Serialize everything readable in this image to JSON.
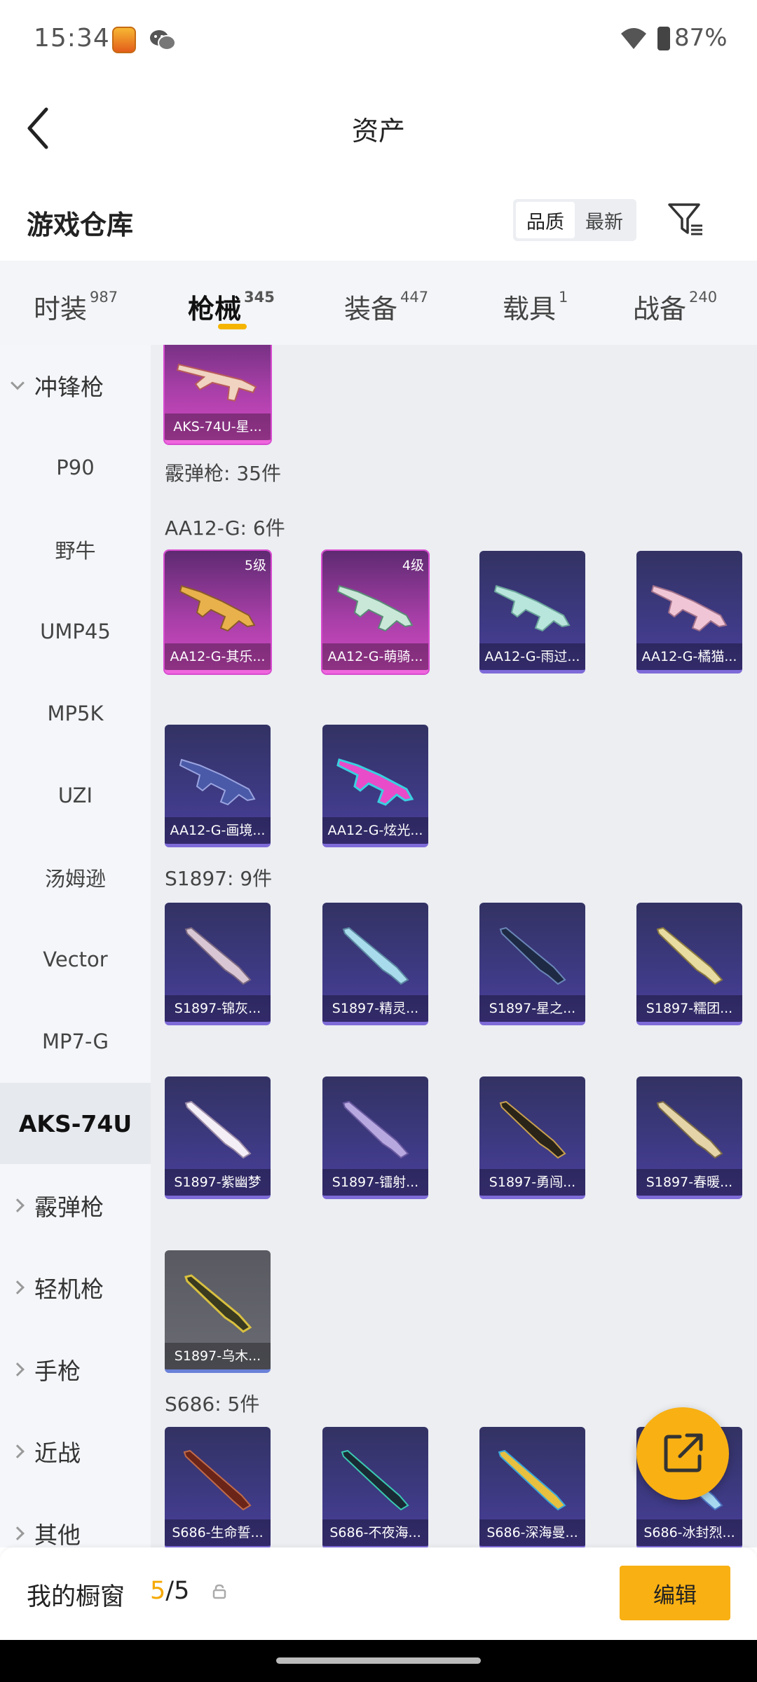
{
  "status_bar": {
    "time": "15:34",
    "battery": "87%"
  },
  "nav": {
    "title": "资产"
  },
  "header": {
    "section_title": "游戏仓库",
    "sort_options": [
      "品质",
      "最新"
    ]
  },
  "tabs": [
    {
      "label": "时装",
      "count": "987"
    },
    {
      "label": "枪械",
      "count": "345",
      "active": true
    },
    {
      "label": "装备",
      "count": "447"
    },
    {
      "label": "载具",
      "count": "1"
    },
    {
      "label": "战备",
      "count": "240"
    }
  ],
  "sidebar": [
    {
      "label": "冲锋枪",
      "type": "group",
      "expanded": true
    },
    {
      "label": "P90"
    },
    {
      "label": "野牛"
    },
    {
      "label": "UMP45"
    },
    {
      "label": "MP5K"
    },
    {
      "label": "UZI"
    },
    {
      "label": "汤姆逊"
    },
    {
      "label": "Vector"
    },
    {
      "label": "MP7-G"
    },
    {
      "label": "AKS-74U",
      "selected": true
    },
    {
      "label": "霰弹枪",
      "type": "group"
    },
    {
      "label": "轻机枪",
      "type": "group"
    },
    {
      "label": "手枪",
      "type": "group"
    },
    {
      "label": "近战",
      "type": "group"
    },
    {
      "label": "其他",
      "type": "group"
    }
  ],
  "content": {
    "top_card": {
      "name": "AKS-74U-星..."
    },
    "shotgun_total": "霰弹枪: 35件",
    "groups": [
      {
        "label": "AA12-G: 6件",
        "items": [
          {
            "name": "AA12-G-其乐...",
            "level": "5级",
            "rarity": "pink"
          },
          {
            "name": "AA12-G-萌骑...",
            "level": "4级",
            "rarity": "pink"
          },
          {
            "name": "AA12-G-雨过...",
            "rarity": "purple"
          },
          {
            "name": "AA12-G-橘猫...",
            "rarity": "purple"
          },
          {
            "name": "AA12-G-画境...",
            "rarity": "purple"
          },
          {
            "name": "AA12-G-炫光...",
            "rarity": "purple"
          }
        ]
      },
      {
        "label": "S1897: 9件",
        "items": [
          {
            "name": "S1897-锦灰...",
            "rarity": "purple"
          },
          {
            "name": "S1897-精灵...",
            "rarity": "purple"
          },
          {
            "name": "S1897-星之...",
            "rarity": "purple"
          },
          {
            "name": "S1897-糯团...",
            "rarity": "purple"
          },
          {
            "name": "S1897-紫幽梦",
            "rarity": "purple"
          },
          {
            "name": "S1897-镭射...",
            "rarity": "purple"
          },
          {
            "name": "S1897-勇闯...",
            "rarity": "purple"
          },
          {
            "name": "S1897-春暖...",
            "rarity": "purple"
          },
          {
            "name": "S1897-乌木...",
            "rarity": "grey"
          }
        ]
      },
      {
        "label": "S686: 5件",
        "items": [
          {
            "name": "S686-生命誓...",
            "rarity": "purple"
          },
          {
            "name": "S686-不夜海...",
            "rarity": "purple"
          },
          {
            "name": "S686-深海曼...",
            "rarity": "purple"
          },
          {
            "name": "S686-冰封烈...",
            "rarity": "purple"
          }
        ]
      }
    ]
  },
  "bottom_bar": {
    "label": "我的橱窗",
    "used": "5",
    "total": "/5",
    "edit_label": "编辑"
  },
  "colors": {
    "accent": "#f8b013",
    "purple_card": "#3e3a84",
    "pink_card": "#a53ea6"
  }
}
